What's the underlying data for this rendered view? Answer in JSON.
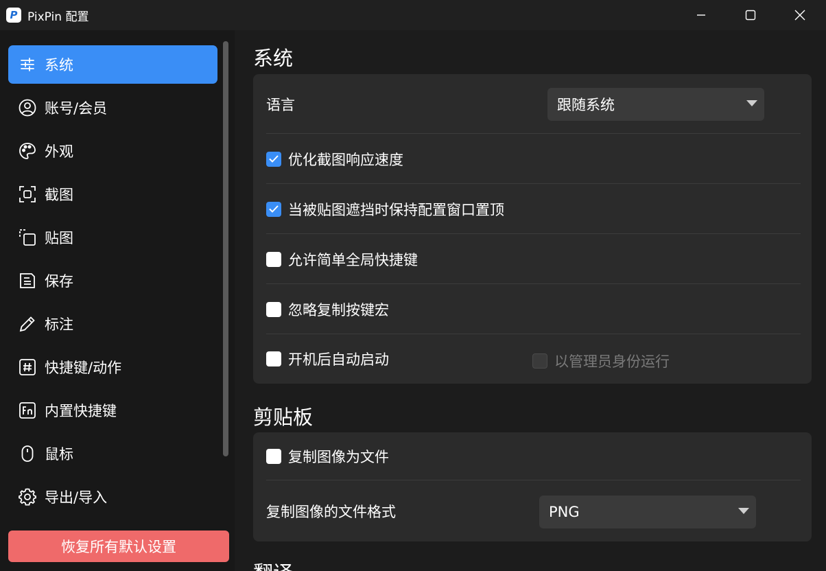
{
  "window": {
    "title": "PixPin 配置",
    "app_icon_letter": "P"
  },
  "sidebar": {
    "items": [
      {
        "label": "系统",
        "icon": "sliders-icon",
        "active": true
      },
      {
        "label": "账号/会员",
        "icon": "user-icon"
      },
      {
        "label": "外观",
        "icon": "palette-icon"
      },
      {
        "label": "截图",
        "icon": "screenshot-icon"
      },
      {
        "label": "贴图",
        "icon": "pin-image-icon"
      },
      {
        "label": "保存",
        "icon": "save-icon"
      },
      {
        "label": "标注",
        "icon": "pencil-icon"
      },
      {
        "label": "快捷键/动作",
        "icon": "hash-icon"
      },
      {
        "label": "内置快捷键",
        "icon": "fn-key-icon"
      },
      {
        "label": "鼠标",
        "icon": "mouse-icon"
      },
      {
        "label": "导出/导入",
        "icon": "gear-icon"
      }
    ],
    "reset_label": "恢复所有默认设置"
  },
  "system": {
    "title": "系统",
    "language_label": "语言",
    "language_value": "跟随系统",
    "options": [
      {
        "label": "优化截图响应速度",
        "checked": true
      },
      {
        "label": "当被贴图遮挡时保持配置窗口置顶",
        "checked": true
      },
      {
        "label": "允许简单全局快捷键",
        "checked": false
      },
      {
        "label": "忽略复制按键宏",
        "checked": false
      },
      {
        "label": "开机后自动启动",
        "checked": false
      }
    ],
    "run_as_admin_label": "以管理员身份运行",
    "run_as_admin_checked": false
  },
  "clipboard": {
    "title": "剪贴板",
    "copy_as_file_label": "复制图像为文件",
    "copy_as_file_checked": false,
    "format_label": "复制图像的文件格式",
    "format_value": "PNG"
  },
  "translate": {
    "title": "翻译"
  },
  "colors": {
    "accent": "#3a8ef6",
    "reset": "#ef6a6a",
    "card": "#2b2b2b"
  }
}
